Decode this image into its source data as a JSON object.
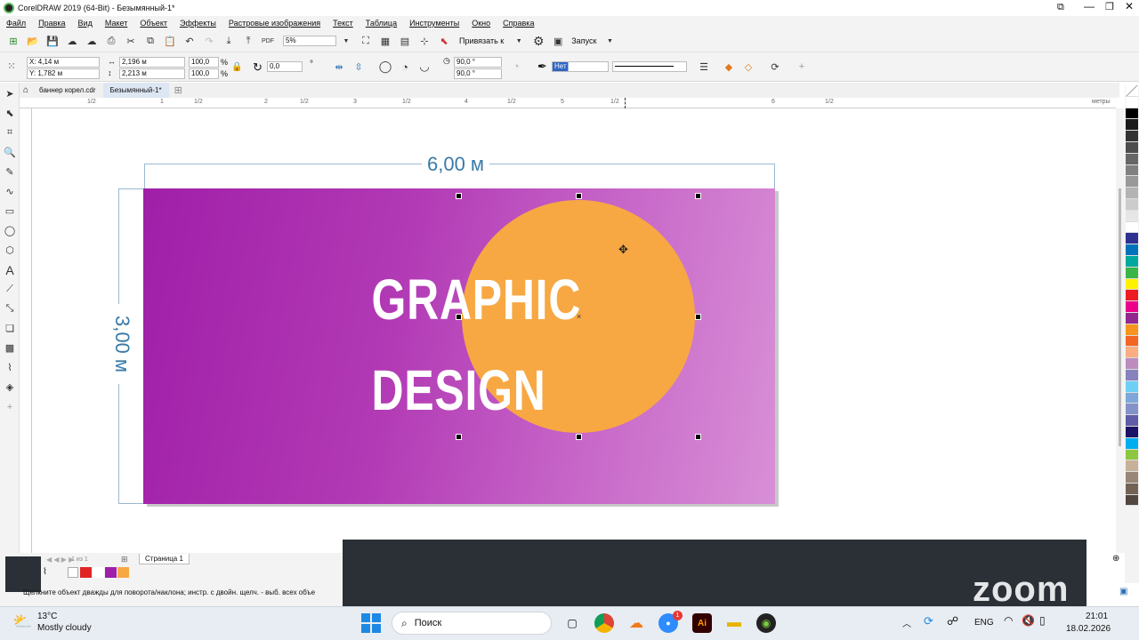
{
  "titlebar": {
    "title": "CorelDRAW 2019 (64-Bit) - Безымянный-1*"
  },
  "menu": [
    "Файл",
    "Правка",
    "Вид",
    "Макет",
    "Объект",
    "Эффекты",
    "Растровые изображения",
    "Текст",
    "Таблица",
    "Инструменты",
    "Окно",
    "Справка"
  ],
  "toolbar1": {
    "zoom": "5%",
    "snap_label": "Привязать к",
    "launch_label": "Запуск"
  },
  "toolbar2": {
    "x": "X: 4,14 м",
    "y": "Y: 1,782 м",
    "w": "2,196 м",
    "h": "2,213 м",
    "sx": "100,0",
    "sy": "100,0",
    "pct": "%",
    "angle": "0,0",
    "deg": "°",
    "arc1": "90,0 °",
    "arc2": "90,0 °",
    "outline": "Нет"
  },
  "tabs": [
    {
      "label": "баннер корел.cdr"
    },
    {
      "label": "Безымянный-1*"
    }
  ],
  "ruler_h": [
    "1/2",
    "1",
    "1/2",
    "2",
    "1/2",
    "3",
    "1/2",
    "4",
    "1/2",
    "5",
    "1/2",
    "6",
    "1/2",
    "метры"
  ],
  "canvas": {
    "dim_width": "6,00 м",
    "dim_height": "3,00 м",
    "headline1": "GRAPHIC",
    "headline2": "DESIGN"
  },
  "status": {
    "page_nav": "1 из 1",
    "page_tab": "Страница 1",
    "hint": "Щелкните объект дважды для поворота/наклона; инстр. с двойн. щелч. - выб. всех объе"
  },
  "zoom_logo": "zoom",
  "taskbar": {
    "temp": "13°C",
    "weather": "Mostly cloudy",
    "search": "Поиск",
    "lang": "ENG",
    "time": "21:01",
    "date": "18.02.2026",
    "badge": "1"
  },
  "colors": {
    "accent": "#f7a843",
    "banner_start": "#a01fa8",
    "banner_end": "#d88fd6",
    "dim": "#3a7aa8"
  },
  "palette": [
    "#ffffff",
    "#000000",
    "#1a1a1a",
    "#333333",
    "#4d4d4d",
    "#666666",
    "#808080",
    "#999999",
    "#b3b3b3",
    "#cccccc",
    "#e6e6e6",
    "#ffffff",
    "#2e3192",
    "#0072bc",
    "#00a99d",
    "#39b54a",
    "#fff200",
    "#ed1c24",
    "#ec008c",
    "#92278f",
    "#f7941d",
    "#f26522",
    "#f9ad81",
    "#bd8cbf",
    "#8781bd",
    "#6dcff6",
    "#7da7d9",
    "#8393ca",
    "#605ca8",
    "#1b1464",
    "#00aeef",
    "#8dc63f",
    "#c7b299",
    "#998675",
    "#736357",
    "#534741"
  ]
}
